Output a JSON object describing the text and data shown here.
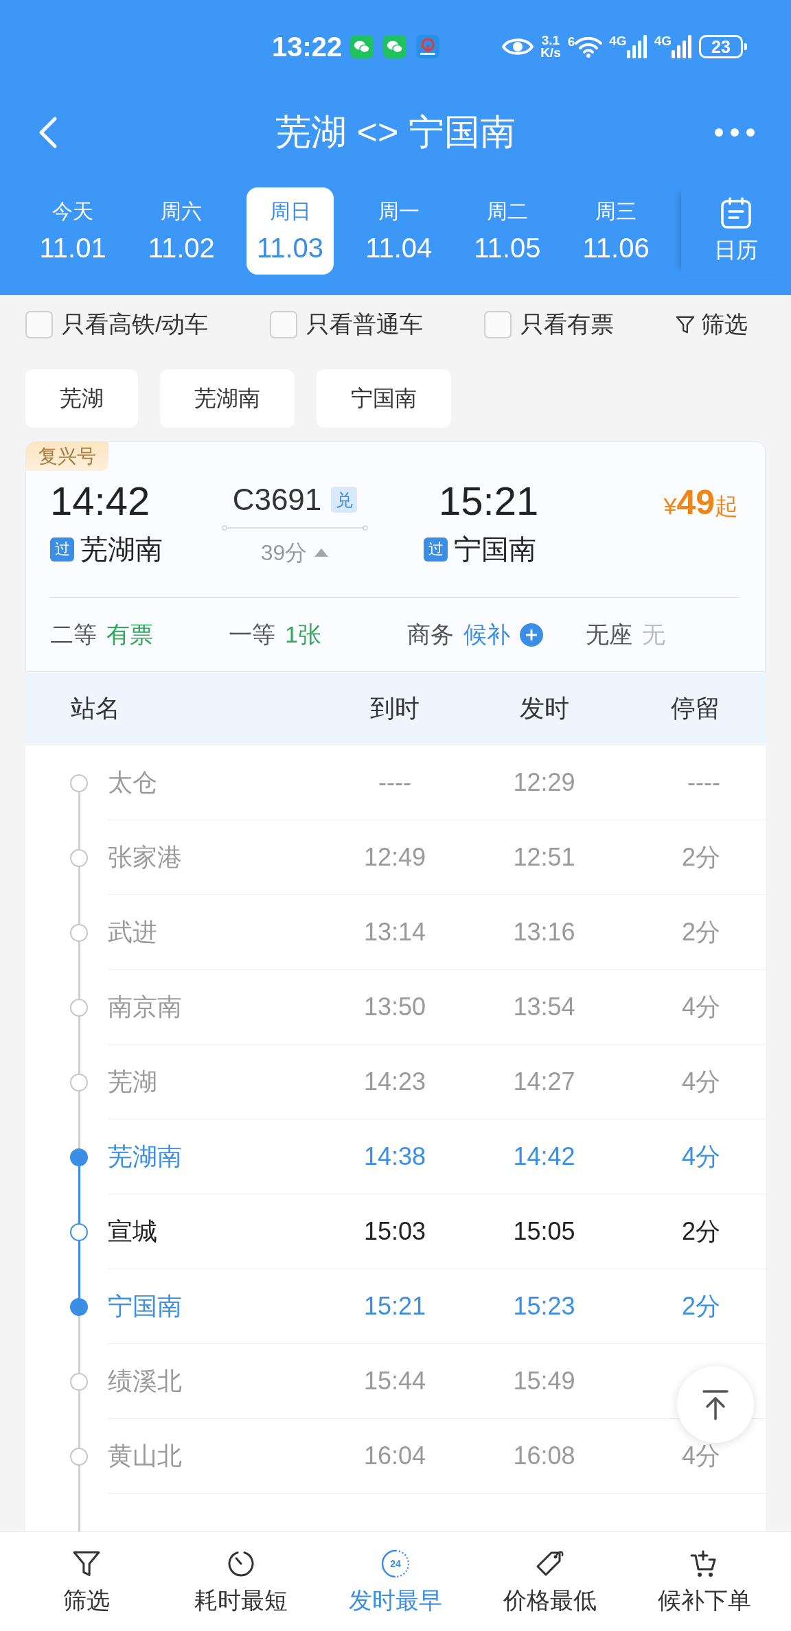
{
  "status_bar": {
    "time": "13:22",
    "net_speed": "3.1",
    "net_speed_unit": "K/s",
    "wifi_label": "6",
    "signals": [
      "4G",
      "4G"
    ],
    "battery": "23"
  },
  "header": {
    "title": "芜湖 <> 宁国南"
  },
  "dates": [
    {
      "weekday": "今天",
      "date": "11.01",
      "selected": false
    },
    {
      "weekday": "周六",
      "date": "11.02",
      "selected": false
    },
    {
      "weekday": "周日",
      "date": "11.03",
      "selected": true
    },
    {
      "weekday": "周一",
      "date": "11.04",
      "selected": false
    },
    {
      "weekday": "周二",
      "date": "11.05",
      "selected": false
    },
    {
      "weekday": "周三",
      "date": "11.06",
      "selected": false
    }
  ],
  "calendar": {
    "label": "日历"
  },
  "filters": {
    "options": [
      {
        "label": "只看高铁/动车",
        "checked": false
      },
      {
        "label": "只看普通车",
        "checked": false
      },
      {
        "label": "只看有票",
        "checked": false
      }
    ],
    "filter_button": "筛选"
  },
  "stations": [
    {
      "label": "芜湖"
    },
    {
      "label": "芜湖南"
    },
    {
      "label": "宁国南"
    }
  ],
  "train": {
    "brand": "复兴号",
    "depart_time": "14:42",
    "depart_tag": "过",
    "depart_station": "芜湖南",
    "number": "C3691",
    "number_tag": "兑",
    "duration": "39分",
    "expanded": true,
    "arrive_time": "15:21",
    "arrive_tag": "过",
    "arrive_station": "宁国南",
    "price": {
      "currency": "¥",
      "amount": "49",
      "suffix": "起"
    },
    "seats": [
      {
        "class": "二等",
        "availability": "有票",
        "kind": "available"
      },
      {
        "class": "一等",
        "availability": "1张",
        "kind": "available"
      },
      {
        "class": "商务",
        "availability": "候补",
        "kind": "waitlist"
      },
      {
        "class": "无座",
        "availability": "无",
        "kind": "none"
      }
    ]
  },
  "stops": {
    "columns": [
      "站名",
      "到时",
      "发时",
      "停留"
    ],
    "rows": [
      {
        "station": "太仓",
        "arrive": "----",
        "depart": "12:29",
        "stop": "----",
        "kind": "outside"
      },
      {
        "station": "张家港",
        "arrive": "12:49",
        "depart": "12:51",
        "stop": "2分",
        "kind": "outside"
      },
      {
        "station": "武进",
        "arrive": "13:14",
        "depart": "13:16",
        "stop": "2分",
        "kind": "outside"
      },
      {
        "station": "南京南",
        "arrive": "13:50",
        "depart": "13:54",
        "stop": "4分",
        "kind": "outside"
      },
      {
        "station": "芜湖",
        "arrive": "14:23",
        "depart": "14:27",
        "stop": "4分",
        "kind": "outside"
      },
      {
        "station": "芜湖南",
        "arrive": "14:38",
        "depart": "14:42",
        "stop": "4分",
        "kind": "endpoint"
      },
      {
        "station": "宣城",
        "arrive": "15:03",
        "depart": "15:05",
        "stop": "2分",
        "kind": "via"
      },
      {
        "station": "宁国南",
        "arrive": "15:21",
        "depart": "15:23",
        "stop": "2分",
        "kind": "endpoint"
      },
      {
        "station": "绩溪北",
        "arrive": "15:44",
        "depart": "15:49",
        "kind": "outside"
      },
      {
        "station": "黄山北",
        "arrive": "16:04",
        "depart": "16:08",
        "stop": "4分",
        "kind": "outside"
      }
    ]
  },
  "bottom_nav": [
    {
      "label": "筛选",
      "selected": false
    },
    {
      "label": "耗时最短",
      "selected": false
    },
    {
      "label": "发时最早",
      "selected": true,
      "icon_text": "24"
    },
    {
      "label": "价格最低",
      "selected": false
    },
    {
      "label": "候补下单",
      "selected": false
    }
  ]
}
